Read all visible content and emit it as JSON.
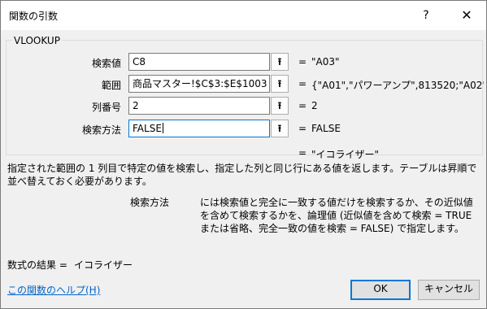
{
  "window": {
    "title": "関数の引数",
    "help_glyph": "?",
    "close_glyph": "✕"
  },
  "function_name": "VLOOKUP",
  "args": [
    {
      "label": "検索値",
      "value": "C8",
      "equals": "=",
      "result": "\"A03\""
    },
    {
      "label": "範囲",
      "value": "商品マスター!$C$3:$E$1003",
      "equals": "=",
      "result": "{\"A01\",\"パワーアンプ\",813520;\"A02\",\""
    },
    {
      "label": "列番号",
      "value": "2",
      "equals": "=",
      "result": "2"
    },
    {
      "label": "検索方法",
      "value": "FALSE",
      "equals": "=",
      "result": "FALSE"
    }
  ],
  "collapse_glyph": "⭱",
  "overall": {
    "equals": "=",
    "result": "\"イコライザー\""
  },
  "description": "指定された範囲の 1 列目で特定の値を検索し、指定した列と同じ行にある値を返します。テーブルは昇順で並べ替えておく必要があります。",
  "arg_help": {
    "name": "検索方法",
    "text": "には検索値と完全に一致する値だけを検索するか、その近似値を含めて検索するかを、論理値 (近似値を含めて検索 = TRUE または省略、完全一致の値を検索 = FALSE) で指定します。"
  },
  "formula_result": {
    "label": "数式の結果 =",
    "value": "イコライザー"
  },
  "help_link": "この関数のヘルプ(H)",
  "buttons": {
    "ok": "OK",
    "cancel": "キャンセル"
  }
}
